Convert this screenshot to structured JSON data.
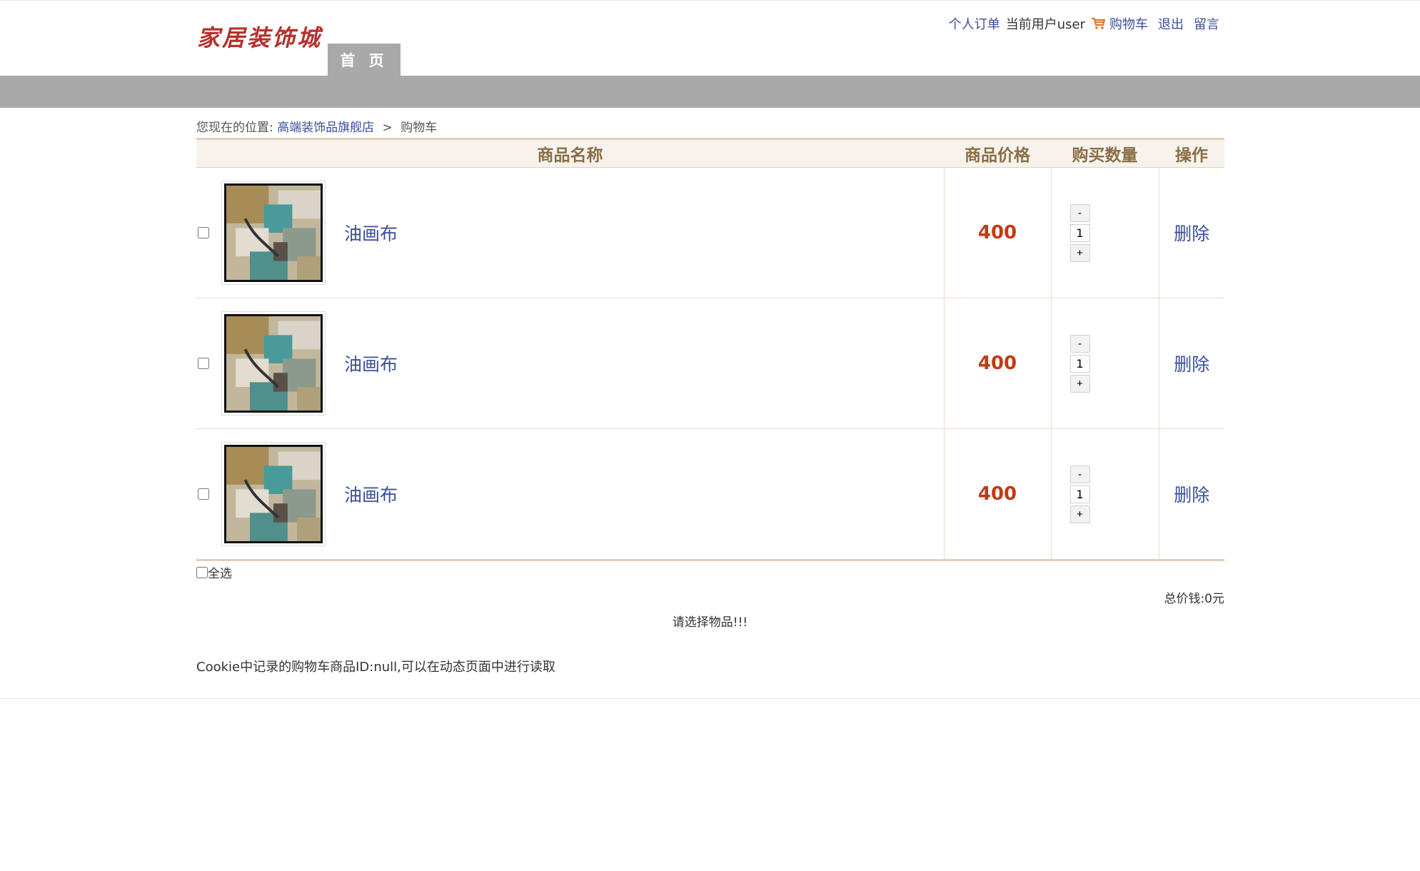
{
  "header": {
    "logo": "家居装饰城",
    "nav_home": "首 页",
    "links": {
      "orders": "个人订单",
      "current_user": "当前用户user",
      "cart": "购物车",
      "logout": "退出",
      "message": "留言"
    }
  },
  "breadcrumb": {
    "prefix": "您现在的位置:",
    "shop": "高端装饰品旗舰店",
    "separator": ">",
    "current": "购物车"
  },
  "table": {
    "headers": {
      "name": "商品名称",
      "price": "商品价格",
      "qty": "购买数量",
      "op": "操作"
    },
    "rows": [
      {
        "name": "油画布",
        "price": "400",
        "qty": "1",
        "minus": "-",
        "plus": "+",
        "delete": "删除"
      },
      {
        "name": "油画布",
        "price": "400",
        "qty": "1",
        "minus": "-",
        "plus": "+",
        "delete": "删除"
      },
      {
        "name": "油画布",
        "price": "400",
        "qty": "1",
        "minus": "-",
        "plus": "+",
        "delete": "删除"
      }
    ]
  },
  "footer": {
    "select_all": "全选",
    "total": "总价钱:0元",
    "hint": "请选择物品!!!",
    "cookie_note": "Cookie中记录的购物车商品ID:null,可以在动态页面中进行读取"
  },
  "colors": {
    "link": "#3b4f9c",
    "price": "#c23a11",
    "header_bg": "#f7f3ec",
    "header_text": "#8a6d45",
    "nav_gray": "#a9a9a9",
    "logo": "#b5322e"
  },
  "icons": {
    "cart": "shopping-cart-icon",
    "thumbnail": "oil-painting-thumbnail"
  }
}
